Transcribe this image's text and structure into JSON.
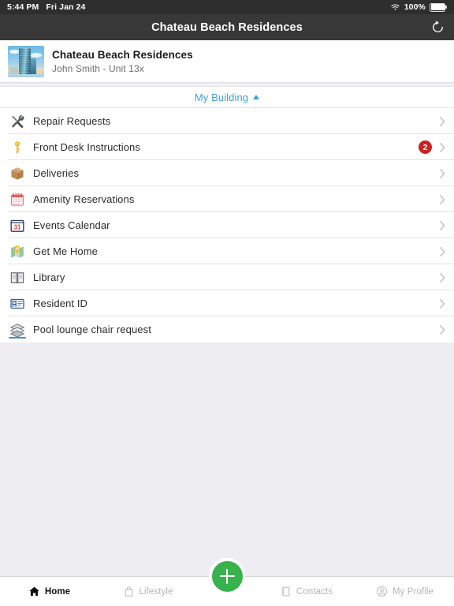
{
  "status_bar": {
    "time": "5:44 PM",
    "date": "Fri Jan 24",
    "wifi_icon": "wifi-icon",
    "battery_percent": "100%",
    "battery_icon": "battery-icon"
  },
  "nav_bar": {
    "title": "Chateau Beach Residences",
    "refresh_icon": "refresh-icon"
  },
  "profile": {
    "thumbnail_icon": "building-photo",
    "building_name": "Chateau Beach Residences",
    "resident_line": "John Smith - Unit 13x"
  },
  "section": {
    "label": "My Building",
    "caret_icon": "caret-up-icon",
    "accent_color": "#3f9fe0"
  },
  "menu": {
    "items": [
      {
        "label": "Repair Requests",
        "icon": "tools-icon",
        "badge": ""
      },
      {
        "label": "Front Desk Instructions",
        "icon": "key-icon",
        "badge": "2"
      },
      {
        "label": "Deliveries",
        "icon": "package-icon",
        "badge": ""
      },
      {
        "label": "Amenity Reservations",
        "icon": "calendar-icon",
        "badge": ""
      },
      {
        "label": "Events Calendar",
        "icon": "calendar-31-icon",
        "badge": ""
      },
      {
        "label": "Get Me Home",
        "icon": "map-pin-icon",
        "badge": ""
      },
      {
        "label": "Library",
        "icon": "open-book-icon",
        "badge": ""
      },
      {
        "label": "Resident ID",
        "icon": "id-card-icon",
        "badge": ""
      },
      {
        "label": "Pool lounge chair request",
        "icon": "layers-icon",
        "badge": ""
      }
    ],
    "chevron_icon": "chevron-right-icon",
    "badge_color": "#cf2222",
    "calendar_day": "31"
  },
  "tab_bar": {
    "tabs": [
      {
        "label": "Home",
        "icon": "home-icon",
        "active": true
      },
      {
        "label": "Lifestyle",
        "icon": "bag-icon",
        "active": false
      },
      {
        "label": "Contacts",
        "icon": "contacts-icon",
        "active": false
      },
      {
        "label": "My Profile",
        "icon": "person-icon",
        "active": false
      }
    ],
    "fab_icon": "plus-icon",
    "fab_color": "#37b24d"
  }
}
